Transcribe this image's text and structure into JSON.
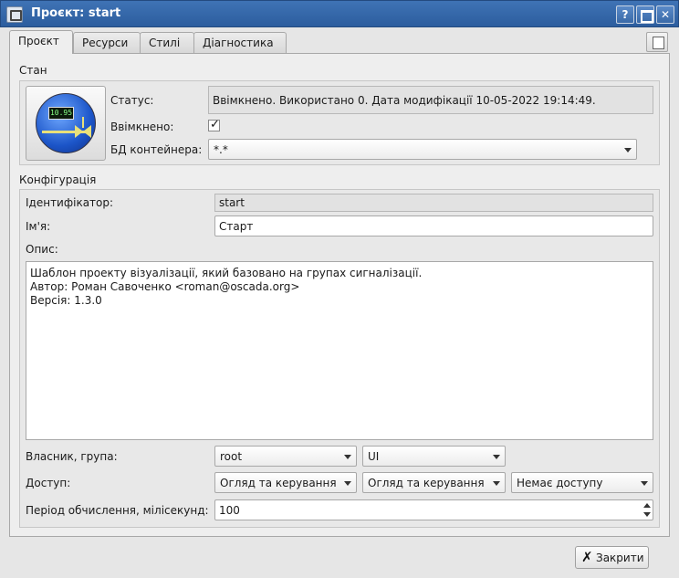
{
  "window": {
    "title": "Проєкт: start",
    "help_label": "?",
    "close_label": "✕"
  },
  "tabs": [
    {
      "label": "Проєкт",
      "active": true
    },
    {
      "label": "Ресурси",
      "active": false
    },
    {
      "label": "Стилі",
      "active": false
    },
    {
      "label": "Діагностика",
      "active": false
    }
  ],
  "state": {
    "section_title": "Стан",
    "status_label": "Статус:",
    "status_value": "Ввімкнено. Використано 0. Дата модифікації 10-05-2022 19:14:49.",
    "enabled_label": "Ввімкнено:",
    "enabled_checked": true,
    "db_label": "БД контейнера:",
    "db_value": "*.*",
    "icon_screen_text": "10.95"
  },
  "config": {
    "section_title": "Конфігурація",
    "id_label": "Ідентифікатор:",
    "id_value": "start",
    "name_label": "Ім'я:",
    "name_value": "Старт",
    "desc_label": "Опис:",
    "desc_lines": [
      "Шаблон проекту візуалізації, який базовано на групах сигналізації.",
      "Автор: Роман Савоченко <roman@oscada.org>",
      "Версія: 1.3.0"
    ],
    "owner_label": "Власник, група:",
    "owner_value": "root",
    "group_value": "UI",
    "access_label": "Доступ:",
    "access_owner": "Огляд та керування",
    "access_group": "Огляд та керування",
    "access_other": "Немає доступу",
    "period_label": "Період обчислення, мілісекунд:",
    "period_value": "100"
  },
  "footer": {
    "close_button_label": "Закрити"
  }
}
